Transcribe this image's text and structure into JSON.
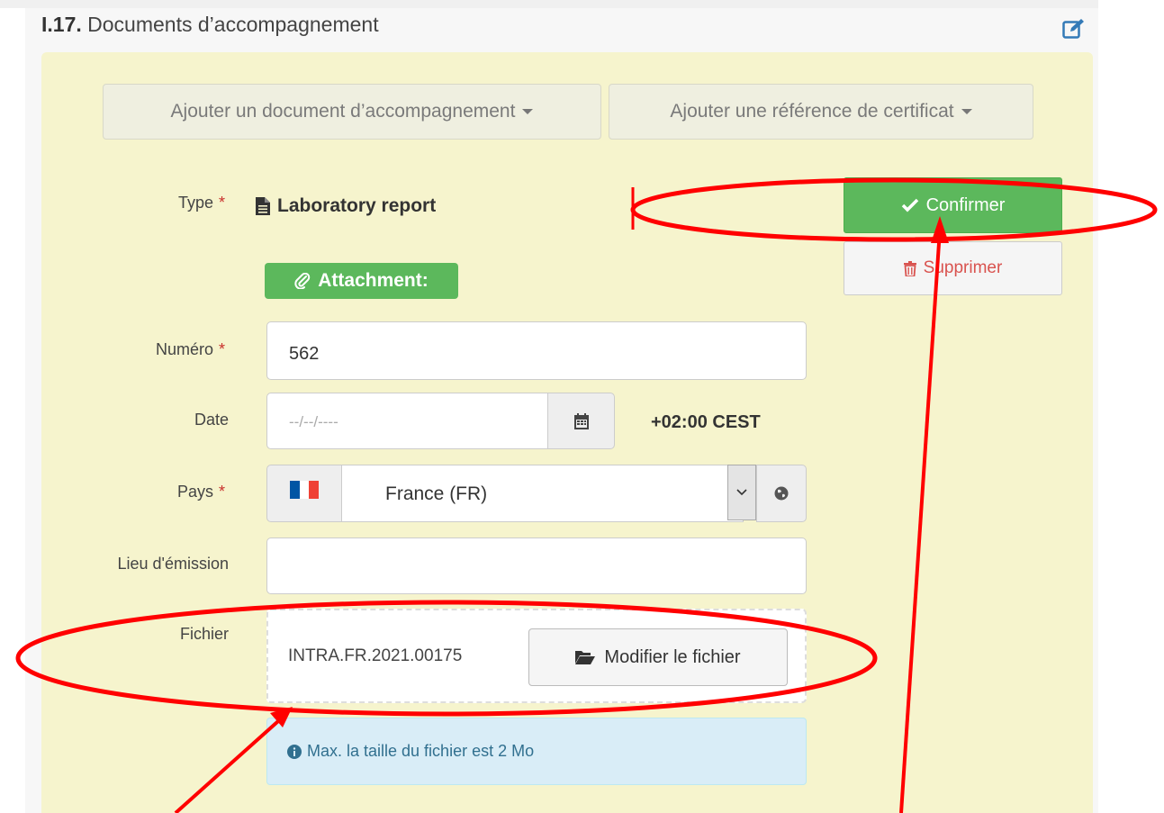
{
  "section": {
    "number": "I.17.",
    "title": "Documents d’accompagnement"
  },
  "toolbar": {
    "add_document_label": "Ajouter un document d’accompagnement",
    "add_certificate_label": "Ajouter une référence de certificat"
  },
  "form": {
    "type": {
      "label": "Type",
      "required_marker": "*",
      "value": "Laboratory report"
    },
    "attachment_badge": "Attachment:",
    "numero": {
      "label": "Numéro",
      "required_marker": "*",
      "value": "562"
    },
    "date": {
      "label": "Date",
      "placeholder": "--/--/----",
      "timezone": "+02:00 CEST"
    },
    "pays": {
      "label": "Pays",
      "required_marker": "*",
      "value": "France (FR)"
    },
    "lieu": {
      "label": "Lieu d'émission",
      "value": ""
    },
    "fichier": {
      "label": "Fichier",
      "file_name": "INTRA.FR.2021.00175",
      "modify_label": "Modifier le fichier"
    },
    "info_text": "Max. la taille du fichier est 2 Mo"
  },
  "actions": {
    "confirm_label": "Confirmer",
    "delete_label": "Supprimer"
  },
  "colors": {
    "success": "#5cb85c",
    "danger": "#d9534f",
    "panel": "#f6f4cd",
    "annotation": "#ff0000"
  }
}
